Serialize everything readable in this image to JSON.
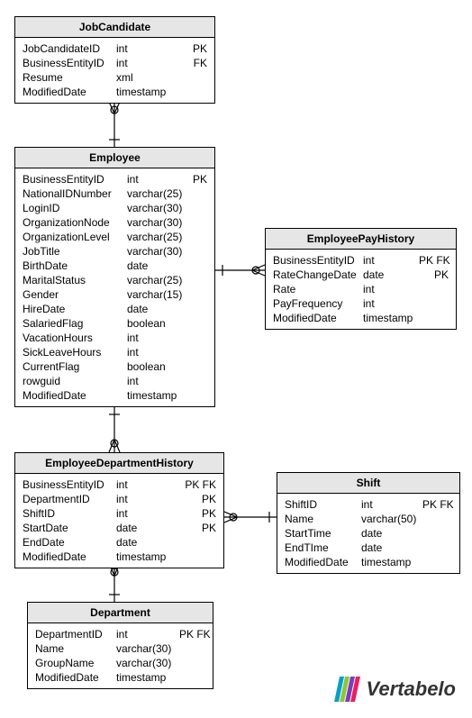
{
  "entities": {
    "jobCandidate": {
      "title": "JobCandidate",
      "rows": [
        {
          "name": "JobCandidateID",
          "type": "int",
          "key": "PK"
        },
        {
          "name": "BusinessEntityID",
          "type": "int",
          "key": "FK"
        },
        {
          "name": "Resume",
          "type": "xml",
          "key": ""
        },
        {
          "name": "ModifiedDate",
          "type": "timestamp",
          "key": ""
        }
      ]
    },
    "employee": {
      "title": "Employee",
      "rows": [
        {
          "name": "BusinessEntityID",
          "type": "int",
          "key": "PK"
        },
        {
          "name": "NationalIDNumber",
          "type": "varchar(25)",
          "key": ""
        },
        {
          "name": "LoginID",
          "type": "varchar(30)",
          "key": ""
        },
        {
          "name": "OrganizationNode",
          "type": "varchar(30)",
          "key": ""
        },
        {
          "name": "OrganizationLevel",
          "type": "varchar(25)",
          "key": ""
        },
        {
          "name": "JobTitle",
          "type": "varchar(30)",
          "key": ""
        },
        {
          "name": "BirthDate",
          "type": "date",
          "key": ""
        },
        {
          "name": "MaritalStatus",
          "type": "varchar(25)",
          "key": ""
        },
        {
          "name": "Gender",
          "type": "varchar(15)",
          "key": ""
        },
        {
          "name": "HireDate",
          "type": "date",
          "key": ""
        },
        {
          "name": "SalariedFlag",
          "type": "boolean",
          "key": ""
        },
        {
          "name": "VacationHours",
          "type": "int",
          "key": ""
        },
        {
          "name": "SickLeaveHours",
          "type": "int",
          "key": ""
        },
        {
          "name": "CurrentFlag",
          "type": "boolean",
          "key": ""
        },
        {
          "name": "rowguid",
          "type": "int",
          "key": ""
        },
        {
          "name": "ModifiedDate",
          "type": "timestamp",
          "key": ""
        }
      ]
    },
    "empPayHistory": {
      "title": "EmployeePayHistory",
      "rows": [
        {
          "name": "BusinessEntityID",
          "type": "int",
          "key": "PK FK"
        },
        {
          "name": "RateChangeDate",
          "type": "date",
          "key": "PK"
        },
        {
          "name": "Rate",
          "type": "int",
          "key": ""
        },
        {
          "name": "PayFrequency",
          "type": "int",
          "key": ""
        },
        {
          "name": "ModifiedDate",
          "type": "timestamp",
          "key": ""
        }
      ]
    },
    "empDeptHistory": {
      "title": "EmployeeDepartmentHistory",
      "rows": [
        {
          "name": "BusinessEntityID",
          "type": "int",
          "key": "PK FK"
        },
        {
          "name": "DepartmentID",
          "type": "int",
          "key": "PK"
        },
        {
          "name": "ShiftID",
          "type": "int",
          "key": "PK"
        },
        {
          "name": "StartDate",
          "type": "date",
          "key": "PK"
        },
        {
          "name": "EndDate",
          "type": "date",
          "key": ""
        },
        {
          "name": "ModifiedDate",
          "type": "timestamp",
          "key": ""
        }
      ]
    },
    "shift": {
      "title": "Shift",
      "rows": [
        {
          "name": "ShiftID",
          "type": "int",
          "key": "PK FK"
        },
        {
          "name": "Name",
          "type": "varchar(50)",
          "key": ""
        },
        {
          "name": "StartTime",
          "type": "date",
          "key": ""
        },
        {
          "name": "EndTIme",
          "type": "date",
          "key": ""
        },
        {
          "name": "ModifiedDate",
          "type": "timestamp",
          "key": ""
        }
      ]
    },
    "department": {
      "title": "Department",
      "rows": [
        {
          "name": "DepartmentID",
          "type": "int",
          "key": "PK FK"
        },
        {
          "name": "Name",
          "type": "varchar(30)",
          "key": ""
        },
        {
          "name": "GroupName",
          "type": "varchar(30)",
          "key": ""
        },
        {
          "name": "ModifiedDate",
          "type": "timestamp",
          "key": ""
        }
      ]
    }
  },
  "logo": {
    "text": "Vertabelo"
  },
  "relationships": [
    {
      "from": "JobCandidate",
      "to": "Employee",
      "type": "zero-or-many-to-one"
    },
    {
      "from": "Employee",
      "to": "EmployeePayHistory",
      "type": "one-to-zero-or-many"
    },
    {
      "from": "Employee",
      "to": "EmployeeDepartmentHistory",
      "type": "one-to-zero-or-many"
    },
    {
      "from": "EmployeeDepartmentHistory",
      "to": "Shift",
      "type": "zero-or-many-to-one"
    },
    {
      "from": "EmployeeDepartmentHistory",
      "to": "Department",
      "type": "zero-or-many-to-one"
    }
  ]
}
